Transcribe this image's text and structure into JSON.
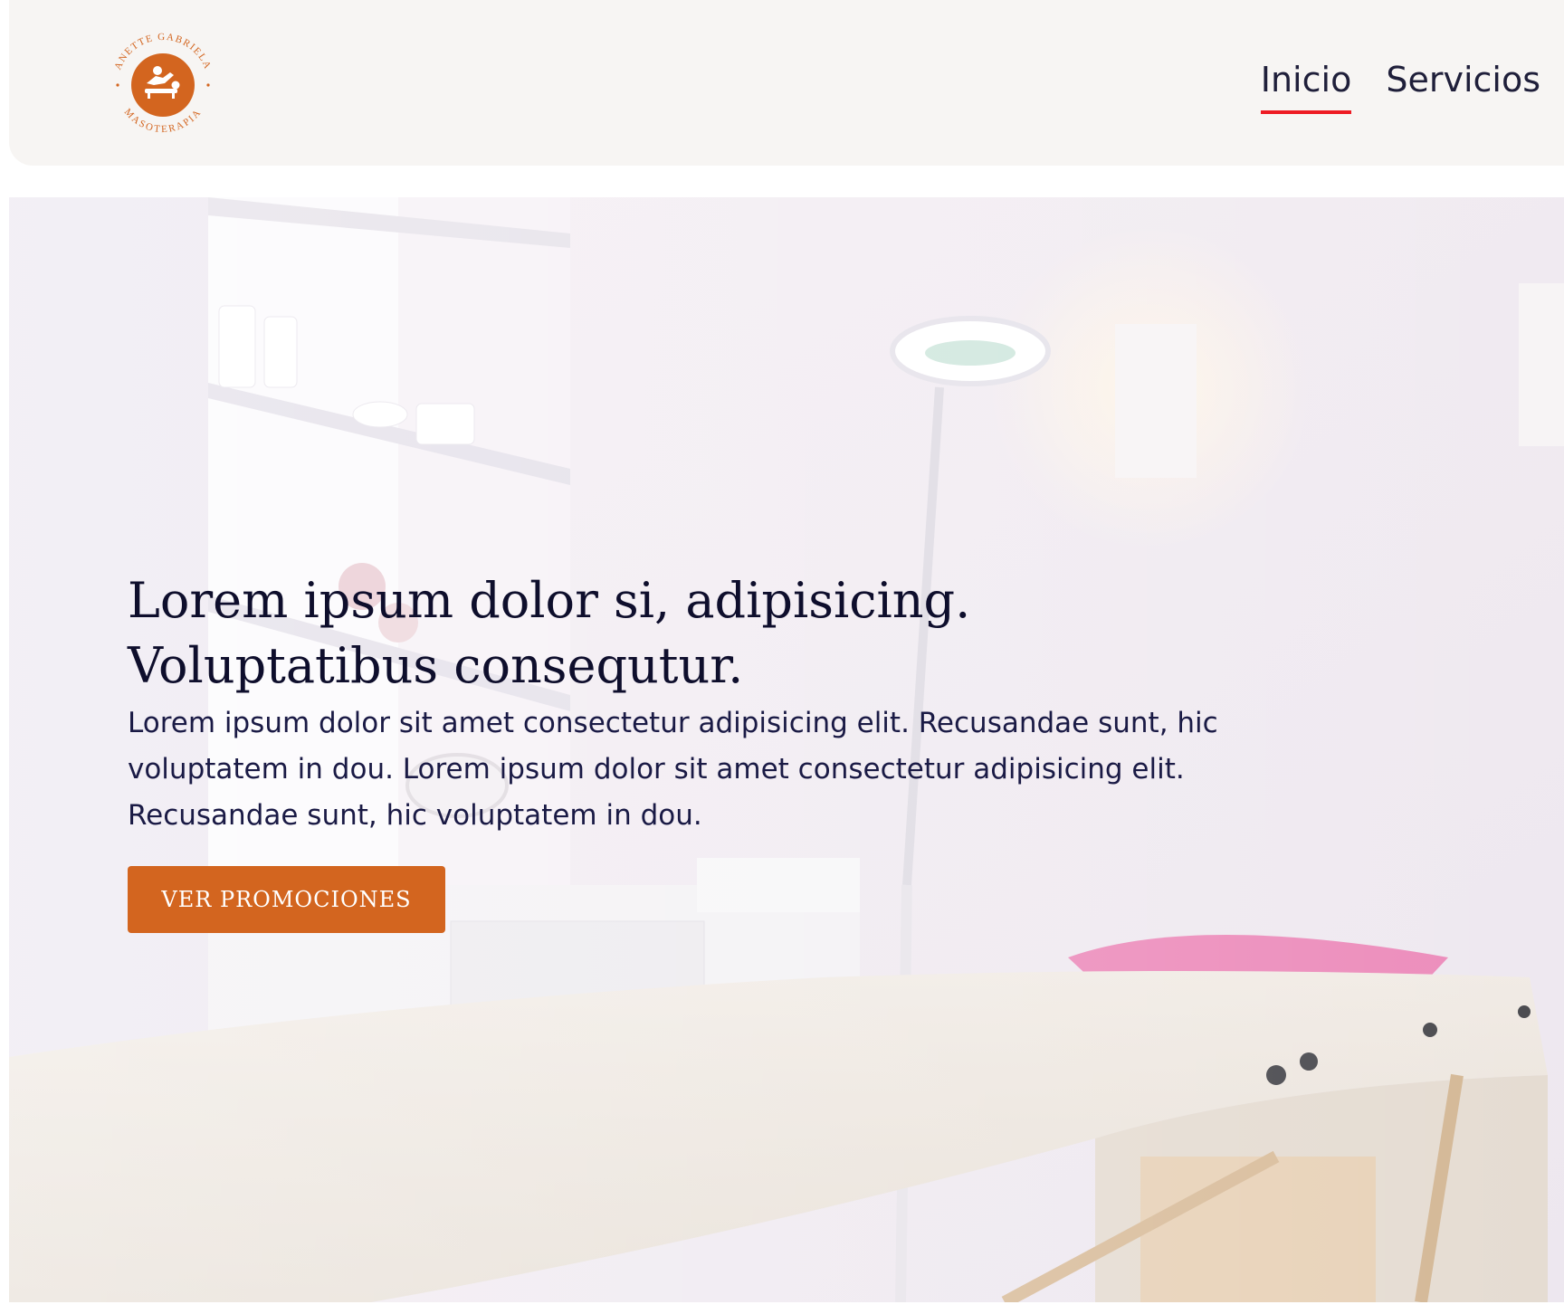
{
  "brand": {
    "name_arc_top": "ANETTE GABRIELA",
    "name_arc_bottom": "MASOTERAPIA",
    "logo_icon": "massage-icon",
    "accent_color": "#d3651f"
  },
  "nav": {
    "items": [
      {
        "label": "Inicio",
        "active": true
      },
      {
        "label": "Servicios",
        "active": false
      }
    ],
    "active_underline_color": "#ee1c24"
  },
  "hero": {
    "title_line1": "Lorem ipsum dolor si, adipisicing.",
    "title_line2": "Voluptatibus consequtur.",
    "paragraph": "Lorem ipsum dolor sit amet consectetur adipisicing elit. Recusandae sunt, hic voluptatem in dou. Lorem ipsum dolor sit amet consectetur adipisicing elit. Recusandae sunt, hic voluptatem in dou.",
    "cta_label": "VER PROMOCIONES"
  }
}
